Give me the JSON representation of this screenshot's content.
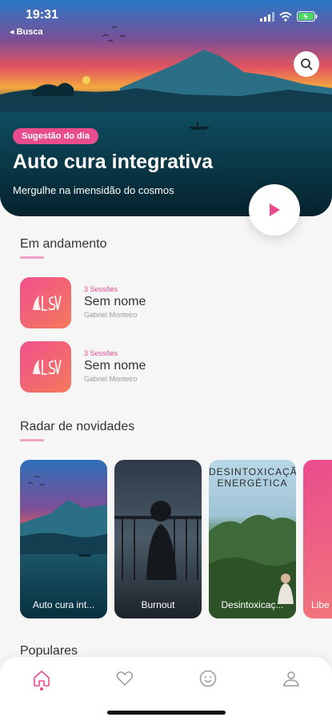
{
  "status_bar": {
    "time": "19:31",
    "back_label": "◂ Busca"
  },
  "hero": {
    "badge": "Sugestão do dia",
    "title": "Auto cura integrativa",
    "subtitle": "Mergulhe na imensidão do cosmos"
  },
  "in_progress": {
    "title": "Em andamento",
    "items": [
      {
        "sessions": "3 Sessões",
        "name": "Sem nome",
        "author": "Gabriel Monteiro"
      },
      {
        "sessions": "3 Sessões",
        "name": "Sem nome",
        "author": "Gabriel Monteiro"
      }
    ]
  },
  "news": {
    "title": "Radar de novidades",
    "cards": [
      {
        "label": "Auto cura int..."
      },
      {
        "label": "Burnout"
      },
      {
        "label": "Desintoxicaç...",
        "overlay_line1": "DESINTOXICAÇÃ",
        "overlay_line2": "ENERGÉTICA"
      },
      {
        "label": "Libe"
      }
    ]
  },
  "popular": {
    "title": "Populares"
  },
  "tabbar": {
    "items": [
      "home-icon",
      "heart-icon",
      "smiley-icon",
      "profile-icon"
    ],
    "active": 0
  },
  "colors": {
    "accent": "#e94c8c",
    "accent_light": "#f2a2c4"
  }
}
